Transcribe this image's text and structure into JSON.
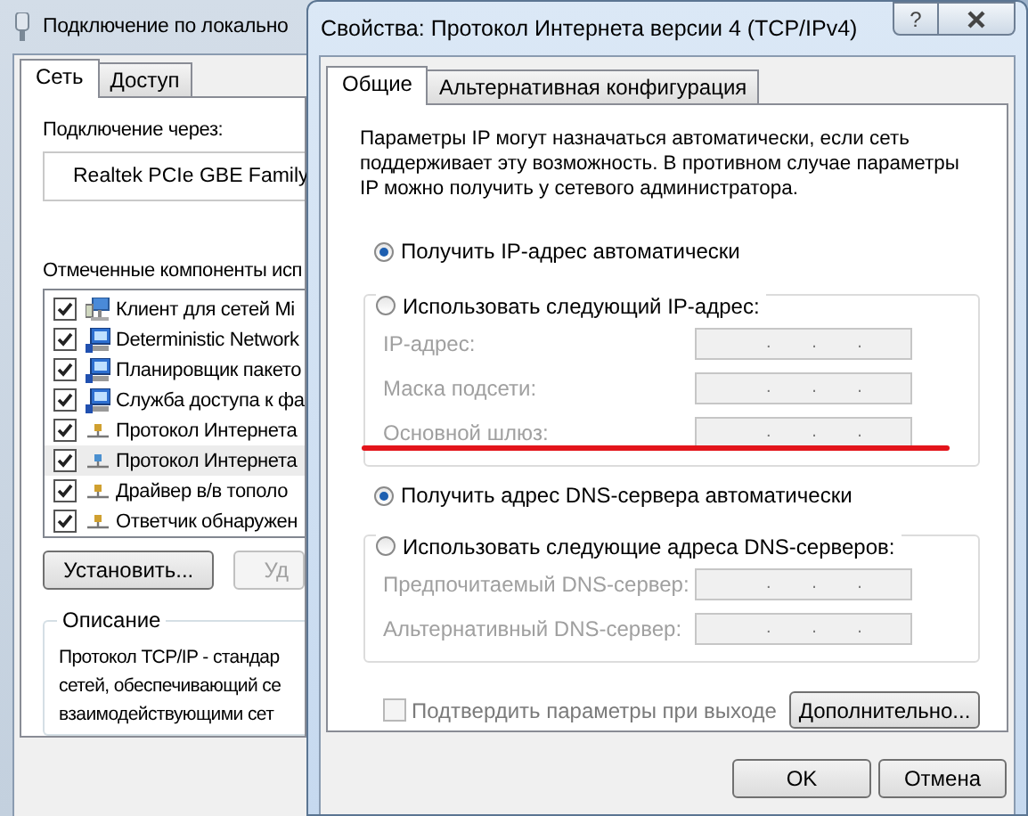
{
  "back_window": {
    "title": "Подключение по локально",
    "tabs": [
      {
        "label": "Сеть",
        "selected": true
      },
      {
        "label": "Доступ",
        "selected": false
      }
    ],
    "connect_via_label": "Подключение через:",
    "adapter": "Realtek PCIe GBE Family",
    "components_label": "Отмеченные компоненты исп",
    "components": [
      {
        "kind": "client",
        "name": "Клиент для сетей Mi",
        "checked": true,
        "selected": false
      },
      {
        "kind": "service",
        "name": "Deterministic Network",
        "checked": true,
        "selected": false
      },
      {
        "kind": "service",
        "name": "Планировщик пакето",
        "checked": true,
        "selected": false
      },
      {
        "kind": "service",
        "name": "Служба доступа к фа",
        "checked": true,
        "selected": false
      },
      {
        "kind": "protocol",
        "name": "Протокол Интернета",
        "checked": true,
        "selected": false
      },
      {
        "kind": "protocol",
        "name": "Протокол Интернета",
        "checked": true,
        "selected": true
      },
      {
        "kind": "protocol",
        "name": "Драйвер в/в тополо",
        "checked": true,
        "selected": false
      },
      {
        "kind": "protocol",
        "name": "Ответчик обнаружен",
        "checked": true,
        "selected": false
      }
    ],
    "buttons": [
      {
        "label": "Установить...",
        "disabled": false
      },
      {
        "label": "Уд",
        "disabled": true
      }
    ],
    "description": {
      "title": "Описание",
      "text": "Протокол TCP/IP - стандар\nсетей, обеспечивающий се\nвзаимодействующими сет"
    }
  },
  "dialog": {
    "title": "Свойства: Протокол Интернета версии 4 (TCP/IPv4)",
    "help": "?",
    "tabs": [
      {
        "label": "Общие",
        "selected": true
      },
      {
        "label": "Альтернативная конфигурация",
        "selected": false
      }
    ],
    "intro": "Параметры IP могут назначаться автоматически, если сеть\nподдерживает эту возможность. В противном случае параметры\nIP можно получить у сетевого администратора.",
    "ip_auto": {
      "label": "Получить IP-адрес автоматически",
      "selected": true
    },
    "ip_manual": {
      "label": "Использовать следующий IP-адрес:",
      "selected": false
    },
    "ip_fields": [
      {
        "label": "IP-адрес:",
        "value": ". . .",
        "disabled": true
      },
      {
        "label": "Маска подсети:",
        "value": ". . .",
        "disabled": true
      },
      {
        "label": "Основной шлюз:",
        "value": ". . .",
        "disabled": true
      }
    ],
    "dns_auto": {
      "label": "Получить адрес DNS-сервера автоматически",
      "selected": true
    },
    "dns_manual": {
      "label": "Использовать следующие адреса DNS-серверов:",
      "selected": false
    },
    "dns_fields": [
      {
        "label": "Предпочитаемый DNS-сервер:",
        "value": ". . .",
        "disabled": true
      },
      {
        "label": "Альтернативный DNS-сервер:",
        "value": ". . .",
        "disabled": true
      }
    ],
    "validate": {
      "label": "Подтвердить параметры при выходе",
      "checked": false,
      "disabled": true
    },
    "advanced_button": "Дополнительно...",
    "buttons": [
      "OK",
      "Отмена"
    ]
  }
}
